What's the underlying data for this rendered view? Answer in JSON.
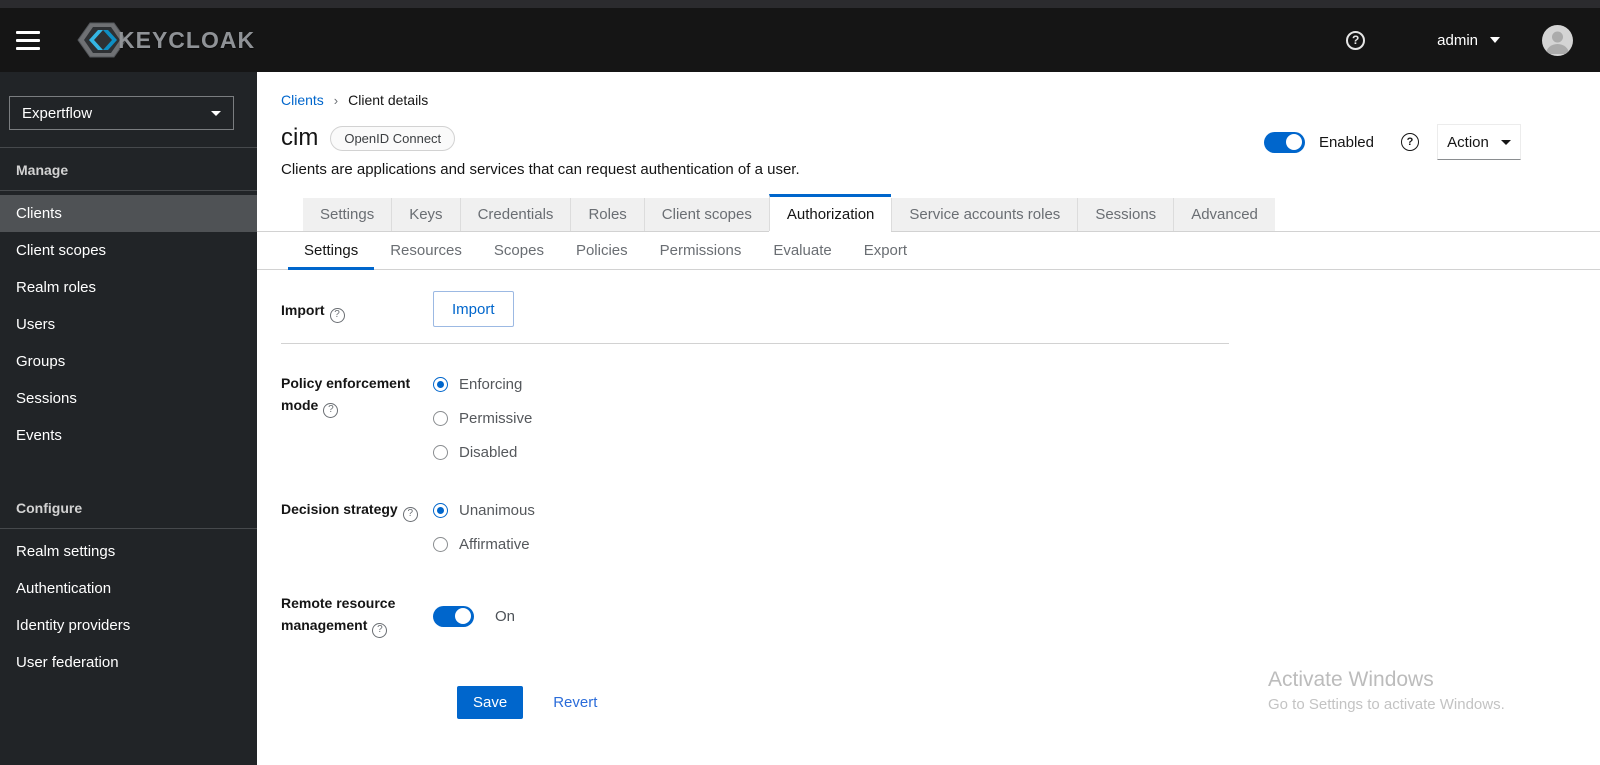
{
  "icons": {
    "question": "?"
  },
  "header": {
    "brand": "KEYCLOAK",
    "user": "admin"
  },
  "sidebar": {
    "realm_selector": "Expertflow",
    "sections": [
      {
        "title": "Manage",
        "items": [
          "Clients",
          "Client scopes",
          "Realm roles",
          "Users",
          "Groups",
          "Sessions",
          "Events"
        ],
        "active": "Clients"
      },
      {
        "title": "Configure",
        "items": [
          "Realm settings",
          "Authentication",
          "Identity providers",
          "User federation"
        ],
        "active": ""
      }
    ]
  },
  "breadcrumb": {
    "items": [
      "Clients",
      "Client details"
    ]
  },
  "page": {
    "title": "cim",
    "badge": "OpenID Connect",
    "description": "Clients are applications and services that can request authentication of a user.",
    "enabled_label": "Enabled",
    "action_label": "Action"
  },
  "main_tabs": [
    "Settings",
    "Keys",
    "Credentials",
    "Roles",
    "Client scopes",
    "Authorization",
    "Service accounts roles",
    "Sessions",
    "Advanced"
  ],
  "main_tabs_active": "Authorization",
  "sub_tabs": [
    "Settings",
    "Resources",
    "Scopes",
    "Policies",
    "Permissions",
    "Evaluate",
    "Export"
  ],
  "sub_tabs_active": "Settings",
  "form": {
    "import": {
      "label": "Import",
      "button": "Import"
    },
    "policy_enforcement": {
      "label": "Policy enforcement mode",
      "options": [
        "Enforcing",
        "Permissive",
        "Disabled"
      ],
      "selected": "Enforcing"
    },
    "decision_strategy": {
      "label": "Decision strategy",
      "options": [
        "Unanimous",
        "Affirmative"
      ],
      "selected": "Unanimous"
    },
    "remote_resource": {
      "label": "Remote resource management",
      "state": "On"
    },
    "save": "Save",
    "revert": "Revert"
  },
  "watermark": {
    "line1": "Activate Windows",
    "line2": "Go to Settings to activate Windows."
  }
}
